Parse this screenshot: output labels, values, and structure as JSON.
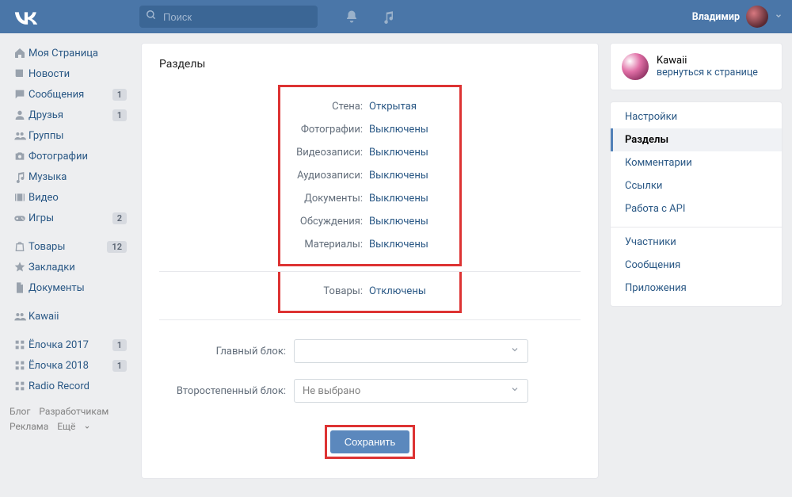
{
  "header": {
    "search_placeholder": "Поиск",
    "username": "Владимир"
  },
  "leftnav": {
    "items": [
      {
        "icon": "home",
        "label": "Моя Страница"
      },
      {
        "icon": "news",
        "label": "Новости"
      },
      {
        "icon": "msg",
        "label": "Сообщения",
        "badge": "1"
      },
      {
        "icon": "friends",
        "label": "Друзья",
        "badge": "1"
      },
      {
        "icon": "groups",
        "label": "Группы"
      },
      {
        "icon": "photo",
        "label": "Фотографии"
      },
      {
        "icon": "music",
        "label": "Музыка"
      },
      {
        "icon": "video",
        "label": "Видео"
      },
      {
        "icon": "games",
        "label": "Игры",
        "badge": "2"
      }
    ],
    "items2": [
      {
        "icon": "market",
        "label": "Товары",
        "badge": "12"
      },
      {
        "icon": "star",
        "label": "Закладки"
      },
      {
        "icon": "docs",
        "label": "Документы"
      }
    ],
    "items3": [
      {
        "icon": "groups",
        "label": "Kawaii"
      }
    ],
    "items4": [
      {
        "icon": "app",
        "label": "Ёлочка 2017",
        "badge": "1"
      },
      {
        "icon": "app",
        "label": "Ёлочка 2018",
        "badge": "1"
      },
      {
        "icon": "app",
        "label": "Radio Record"
      }
    ],
    "footer": [
      "Блог",
      "Разработчикам",
      "Реклама",
      "Ещё"
    ]
  },
  "main": {
    "title": "Разделы",
    "settings1": [
      {
        "label": "Стена:",
        "value": "Открытая"
      },
      {
        "label": "Фотографии:",
        "value": "Выключены"
      },
      {
        "label": "Видеозаписи:",
        "value": "Выключены"
      },
      {
        "label": "Аудиозаписи:",
        "value": "Выключены"
      },
      {
        "label": "Документы:",
        "value": "Выключены"
      },
      {
        "label": "Обсуждения:",
        "value": "Выключены"
      },
      {
        "label": "Материалы:",
        "value": "Выключены"
      }
    ],
    "settings2": [
      {
        "label": "Товары:",
        "value": "Отключены"
      }
    ],
    "form": {
      "main_block_label": "Главный блок:",
      "main_block_value": "",
      "secondary_block_label": "Второстепенный блок:",
      "secondary_block_value": "Не выбрано"
    },
    "save_label": "Сохранить"
  },
  "right": {
    "group_name": "Kawaii",
    "group_back": "вернуться к странице",
    "nav": [
      {
        "label": "Настройки"
      },
      {
        "label": "Разделы",
        "active": true
      },
      {
        "label": "Комментарии"
      },
      {
        "label": "Ссылки"
      },
      {
        "label": "Работа с API"
      }
    ],
    "nav2": [
      {
        "label": "Участники"
      },
      {
        "label": "Сообщения"
      },
      {
        "label": "Приложения"
      }
    ]
  }
}
